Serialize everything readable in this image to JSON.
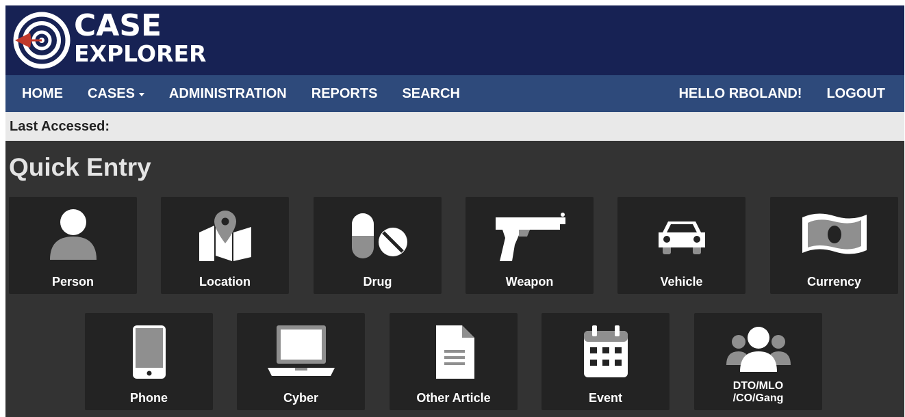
{
  "brand": {
    "line1": "CASE",
    "line2": "EXPLORER",
    "colors": {
      "brandbar": "#172254",
      "navbar": "#2e4a7b",
      "accent": "#c0392b"
    }
  },
  "nav": {
    "items": [
      {
        "label": "HOME"
      },
      {
        "label": "CASES",
        "has_dropdown": true
      },
      {
        "label": "ADMINISTRATION"
      },
      {
        "label": "REPORTS"
      },
      {
        "label": "SEARCH"
      }
    ],
    "greeting": "HELLO RBOLAND!",
    "logout": "LOGOUT"
  },
  "last_accessed": {
    "label": "Last Accessed:",
    "value": ""
  },
  "quick_entry": {
    "title": "Quick Entry",
    "tiles": [
      {
        "label": "Person",
        "icon": "person-icon"
      },
      {
        "label": "Location",
        "icon": "map-pin-icon"
      },
      {
        "label": "Drug",
        "icon": "pills-icon"
      },
      {
        "label": "Weapon",
        "icon": "pistol-icon"
      },
      {
        "label": "Vehicle",
        "icon": "car-icon"
      },
      {
        "label": "Currency",
        "icon": "money-bill-icon"
      },
      {
        "label": "Phone",
        "icon": "phone-icon"
      },
      {
        "label": "Cyber",
        "icon": "laptop-icon"
      },
      {
        "label": "Other Article",
        "icon": "document-icon"
      },
      {
        "label": "Event",
        "icon": "calendar-icon"
      },
      {
        "label_line1": "DTO/MLO",
        "label_line2": "/CO/Gang",
        "icon": "group-icon"
      }
    ]
  }
}
